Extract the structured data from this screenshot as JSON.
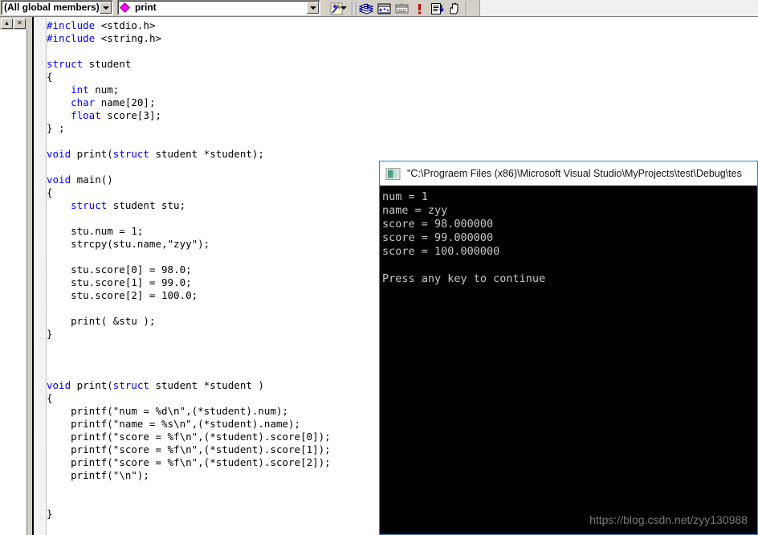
{
  "toolbar": {
    "scope_combo": {
      "value": "(All global members)",
      "arrow_icon": "chevron-down-icon"
    },
    "member_combo": {
      "value": "print",
      "member_icon": "function-member-icon",
      "arrow_icon": "chevron-down-icon"
    },
    "buttons": [
      {
        "name": "find-in-files-button",
        "icon": "magic-wand-icon",
        "label": ""
      },
      {
        "name": "bookmark-stack-button",
        "icon": "books-stack-icon",
        "label": ""
      },
      {
        "name": "new-window-button",
        "icon": "window-stars-icon",
        "label": ""
      },
      {
        "name": "keyboard-window-button",
        "icon": "window-keyboard-icon",
        "label": ""
      },
      {
        "name": "important-button",
        "icon": "exclamation-icon",
        "label": ""
      },
      {
        "name": "document-down-button",
        "icon": "document-down-arrow-icon",
        "label": ""
      },
      {
        "name": "hand-button",
        "icon": "hand-icon",
        "label": ""
      }
    ]
  },
  "mdi": {
    "restore_label": "▴",
    "close_label": "✕"
  },
  "editor": {
    "lines": [
      [
        {
          "t": "#include",
          "c": "kw"
        },
        {
          "t": " <stdio.h>",
          "c": ""
        }
      ],
      [
        {
          "t": "#include",
          "c": "kw"
        },
        {
          "t": " <string.h>",
          "c": ""
        }
      ],
      [],
      [
        {
          "t": "struct",
          "c": "kw"
        },
        {
          "t": " student",
          "c": ""
        }
      ],
      [
        {
          "t": "{",
          "c": ""
        }
      ],
      [
        {
          "t": "    ",
          "c": ""
        },
        {
          "t": "int",
          "c": "kw"
        },
        {
          "t": " num;",
          "c": ""
        }
      ],
      [
        {
          "t": "    ",
          "c": ""
        },
        {
          "t": "char",
          "c": "kw"
        },
        {
          "t": " name[20];",
          "c": ""
        }
      ],
      [
        {
          "t": "    ",
          "c": ""
        },
        {
          "t": "float",
          "c": "kw"
        },
        {
          "t": " score[3];",
          "c": ""
        }
      ],
      [
        {
          "t": "} ;",
          "c": ""
        }
      ],
      [],
      [
        {
          "t": "void",
          "c": "kw"
        },
        {
          "t": " print(",
          "c": ""
        },
        {
          "t": "struct",
          "c": "kw"
        },
        {
          "t": " student *student);",
          "c": ""
        }
      ],
      [],
      [
        {
          "t": "void",
          "c": "kw"
        },
        {
          "t": " main()",
          "c": ""
        }
      ],
      [
        {
          "t": "{",
          "c": ""
        }
      ],
      [
        {
          "t": "    ",
          "c": ""
        },
        {
          "t": "struct",
          "c": "kw"
        },
        {
          "t": " student stu;",
          "c": ""
        }
      ],
      [],
      [
        {
          "t": "    stu.num = 1;",
          "c": ""
        }
      ],
      [
        {
          "t": "    strcpy(stu.name,\"zyy\");",
          "c": ""
        }
      ],
      [],
      [
        {
          "t": "    stu.score[0] = 98.0;",
          "c": ""
        }
      ],
      [
        {
          "t": "    stu.score[1] = 99.0;",
          "c": ""
        }
      ],
      [
        {
          "t": "    stu.score[2] = 100.0;",
          "c": ""
        }
      ],
      [],
      [
        {
          "t": "    print( &stu );",
          "c": ""
        }
      ],
      [
        {
          "t": "}",
          "c": ""
        }
      ],
      [],
      [],
      [],
      [
        {
          "t": "void",
          "c": "kw"
        },
        {
          "t": " print(",
          "c": ""
        },
        {
          "t": "struct",
          "c": "kw"
        },
        {
          "t": " student *student )",
          "c": ""
        }
      ],
      [
        {
          "t": "{",
          "c": ""
        }
      ],
      [
        {
          "t": "    printf(\"num = %d\\n\",(*student).num);",
          "c": ""
        }
      ],
      [
        {
          "t": "    printf(\"name = %s\\n\",(*student).name);",
          "c": ""
        }
      ],
      [
        {
          "t": "    printf(\"score = %f\\n\",(*student).score[0]);",
          "c": ""
        }
      ],
      [
        {
          "t": "    printf(\"score = %f\\n\",(*student).score[1]);",
          "c": ""
        }
      ],
      [
        {
          "t": "    printf(\"score = %f\\n\",(*student).score[2]);",
          "c": ""
        }
      ],
      [
        {
          "t": "    printf(\"\\n\");",
          "c": ""
        }
      ],
      [],
      [],
      [
        {
          "t": "}",
          "c": ""
        }
      ]
    ]
  },
  "console": {
    "icon": "console-window-icon",
    "title": "\"C:\\Prograem Files (x86)\\Microsoft Visual Studio\\MyProjects\\test\\Debug\\tes",
    "output": [
      "num = 1",
      "name = zyy",
      "score = 98.000000",
      "score = 99.000000",
      "score = 100.000000",
      "",
      "Press any key to continue"
    ]
  },
  "watermark": {
    "text": "https://blog.csdn.net/zyy130988"
  },
  "colors": {
    "keyword": "#0000ff",
    "console_bg": "#000000",
    "console_text": "#c8c8c8",
    "window_border": "#1f8ad6",
    "toolbar_bg": "#d4d0c8"
  }
}
